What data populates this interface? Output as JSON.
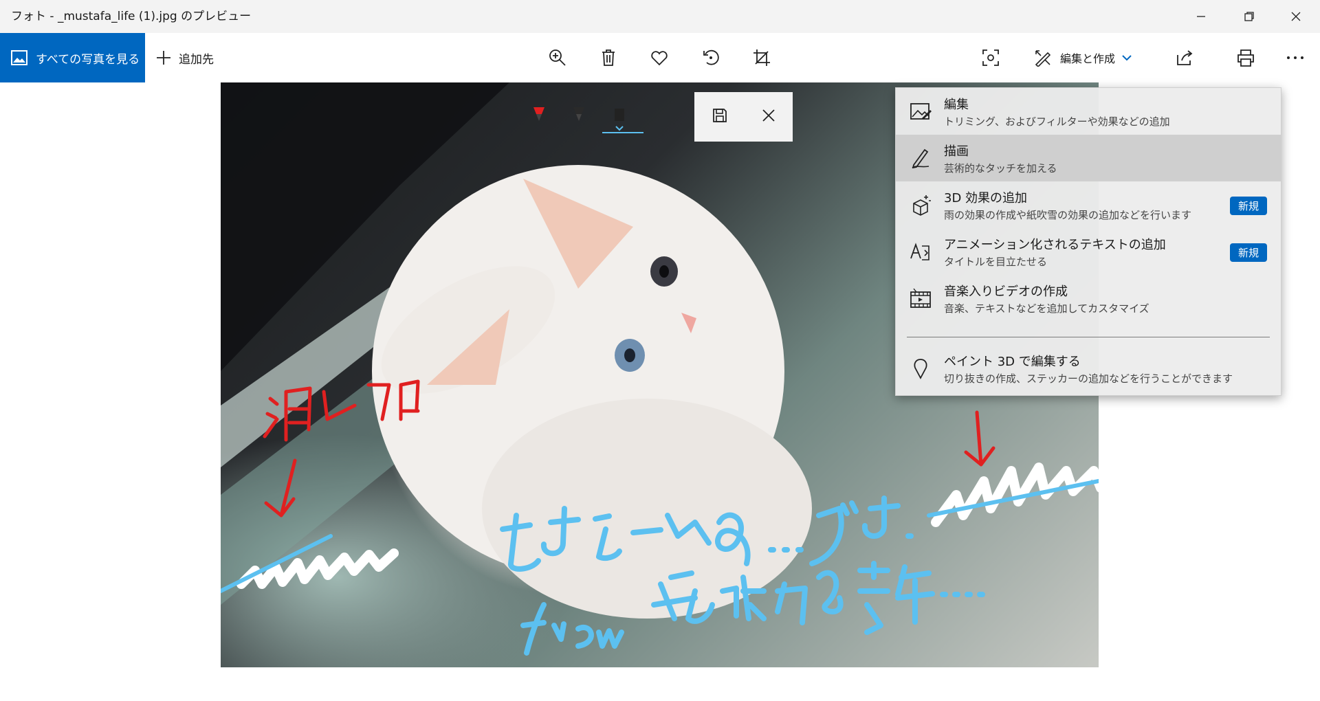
{
  "window": {
    "title": "フォト - _mustafa_life (1).jpg のプレビュー"
  },
  "toolbar": {
    "all_photos_label": "すべての写真を見る",
    "add_to_label": "追加先",
    "edit_create_label": "編集と作成",
    "icons": [
      "zoom-in-icon",
      "delete-icon",
      "heart-icon",
      "rotate-icon",
      "crop-icon",
      "camera-focus-icon",
      "edit-create-icon",
      "share-icon",
      "print-icon",
      "more-icon"
    ]
  },
  "menu": {
    "items": [
      {
        "title": "編集",
        "subtitle": "トリミング、およびフィルターや効果などの追加",
        "icon": "edit-image-icon"
      },
      {
        "title": "描画",
        "subtitle": "芸術的なタッチを加える",
        "icon": "draw-pen-icon"
      },
      {
        "title": "3D 効果の追加",
        "subtitle": "雨の効果の作成や紙吹雪の効果の追加などを行います",
        "badge": "新規",
        "icon": "3d-effects-icon"
      },
      {
        "title": "アニメーション化されるテキストの追加",
        "subtitle": "タイトルを目立たせる",
        "badge": "新規",
        "icon": "animated-text-icon"
      },
      {
        "title": "音楽入りビデオの作成",
        "subtitle": "音楽、テキストなどを追加してカスタマイズ",
        "icon": "video-icon"
      },
      {
        "title": "ペイント 3D で編集する",
        "subtitle": "切り抜きの作成、ステッカーの追加などを行うことができます",
        "icon": "paint3d-icon"
      }
    ]
  },
  "colors": {
    "accent": "#0067c0",
    "ink_red": "#e02020",
    "ink_blue": "#5cc0f0",
    "ink_white": "#ffffff"
  }
}
